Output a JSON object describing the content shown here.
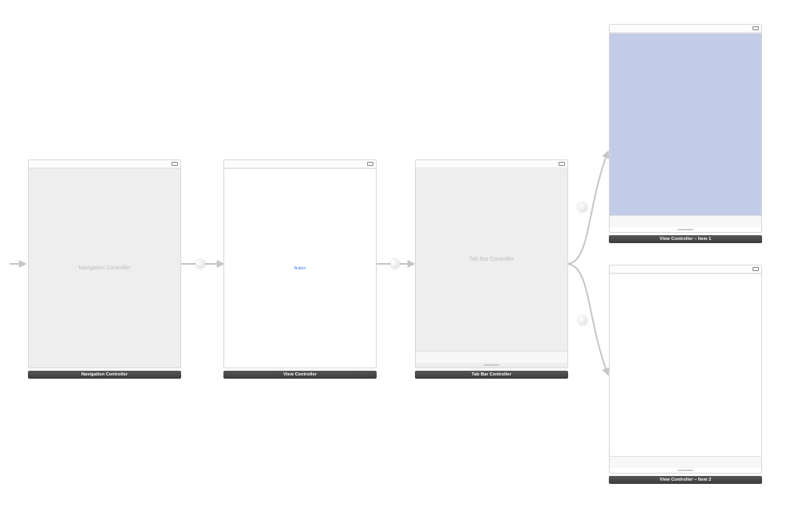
{
  "scenes": {
    "nav": {
      "label": "Navigation Controller",
      "placeholder": "Navigation Controller"
    },
    "view": {
      "label": "View Controller",
      "button": "Button"
    },
    "tab": {
      "label": "Tab Bar Controller",
      "placeholder": "Tab Bar Controller"
    },
    "item1": {
      "label": "View Controller – Item 1"
    },
    "item2": {
      "label": "View Controller – Item 2"
    }
  }
}
